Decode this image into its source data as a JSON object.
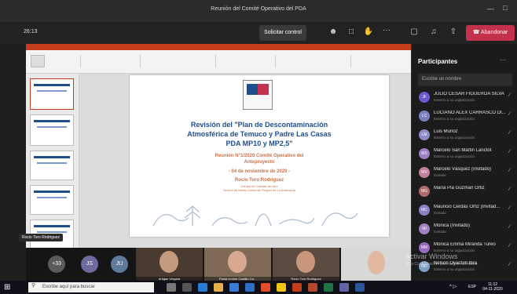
{
  "window": {
    "title": "Reunión del Comité Operativo del PDA"
  },
  "toolbar": {
    "timer": "26:13",
    "control_label": "Solicitar control",
    "hangup_label": "Abandonar"
  },
  "slide": {
    "title_line1": "Revisión del \"Plan de Descontaminación",
    "title_line2": "Atmosférica de Temuco y Padre Las Casas",
    "title_line3": "PDA MP10 y MP2,5\"",
    "meeting_line1": "Reunión N°1/2020 Comité Operativo del",
    "meeting_line2": "Anteproyecto",
    "date": "- 04 de noviembre de 2020 -",
    "presenter": "Rocío Toro Rodriguez",
    "presenter_role1": "Unidad de Calidad del Aire",
    "presenter_role2": "Seremi de Medio Ambiente Región de La Araucanía",
    "notes_placeholder": "Haga clic para agregar notas"
  },
  "presenter_tag": "Rocio Toro Rodriguez",
  "panel": {
    "title": "Participantes",
    "search_placeholder": "Escribe un nombre",
    "participants": [
      {
        "initials": "JF",
        "name": "JULIO CESAR FIGUEROA SILVA",
        "sub": "Externo a su organización"
      },
      {
        "initials": "LC",
        "name": "LUCIANO ALEX CARRASCO DI...",
        "sub": "Externo a su organización"
      },
      {
        "initials": "LM",
        "name": "Luis Muñoz",
        "sub": "Externo a su organización"
      },
      {
        "initials": "MS",
        "name": "Marcelo San Martin Lanctot",
        "sub": "Externo a su organización"
      },
      {
        "initials": "MV",
        "name": "Marcelo Vásquez (Invitado)",
        "sub": "Invitado"
      },
      {
        "initials": "MG",
        "name": "María Pía Guzman Ortiz",
        "sub": ""
      },
      {
        "initials": "MC",
        "name": "Mauricio Cerdas Ortiz (Invitad...",
        "sub": "Invitado"
      },
      {
        "initials": "MI",
        "name": "Monica (Invitado)",
        "sub": "Invitado"
      },
      {
        "initials": "MM",
        "name": "Monica Emma Miranda Tureo",
        "sub": "Externo a su organización"
      },
      {
        "initials": "NO",
        "name": "Nelson Oyarzún Ibra",
        "sub": "Externo a su organización"
      }
    ]
  },
  "video_strip": {
    "overflow_count": "+33",
    "bubble_initials": [
      "JS",
      "JU"
    ],
    "tiles": [
      "Artigas Vergara",
      "Paula Ivonne Castillo Ca...",
      "Rocio Toro Rodriguez"
    ]
  },
  "watermark": {
    "line1": "Activar Windows",
    "line2": "Ve a Configuración para activar Windows."
  },
  "taskbar": {
    "search_placeholder": "Escribe aquí para buscar",
    "language": "ESP",
    "time": "11:12",
    "date": "04-11-2020"
  }
}
